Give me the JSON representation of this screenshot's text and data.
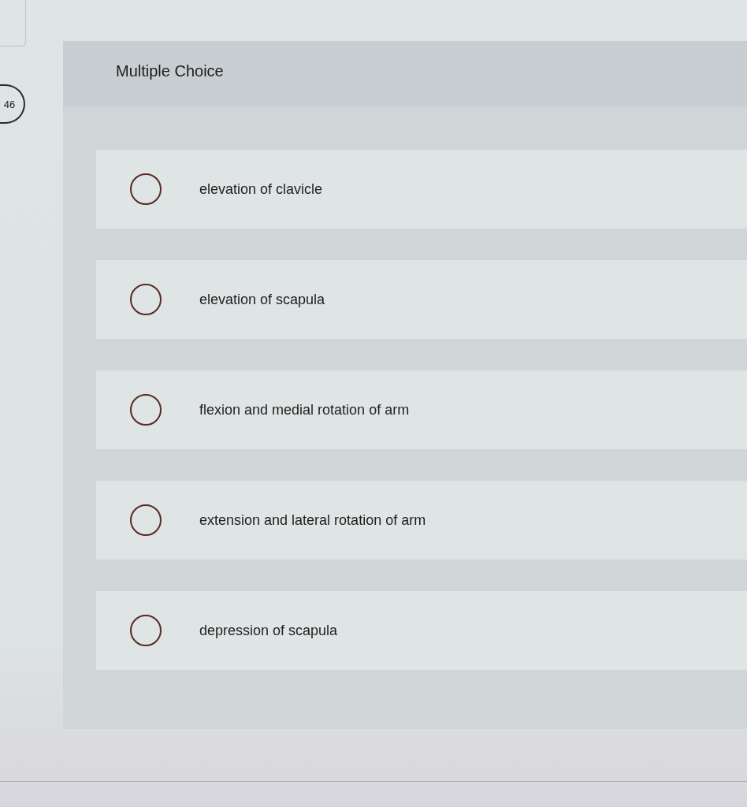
{
  "question_number": "46",
  "question": {
    "type_label": "Multiple Choice",
    "options": [
      {
        "label": "elevation of clavicle",
        "selected": false
      },
      {
        "label": "elevation of scapula",
        "selected": false
      },
      {
        "label": "flexion and medial rotation of arm",
        "selected": false
      },
      {
        "label": "extension and lateral rotation of arm",
        "selected": false
      },
      {
        "label": "depression of scapula",
        "selected": false
      }
    ]
  }
}
